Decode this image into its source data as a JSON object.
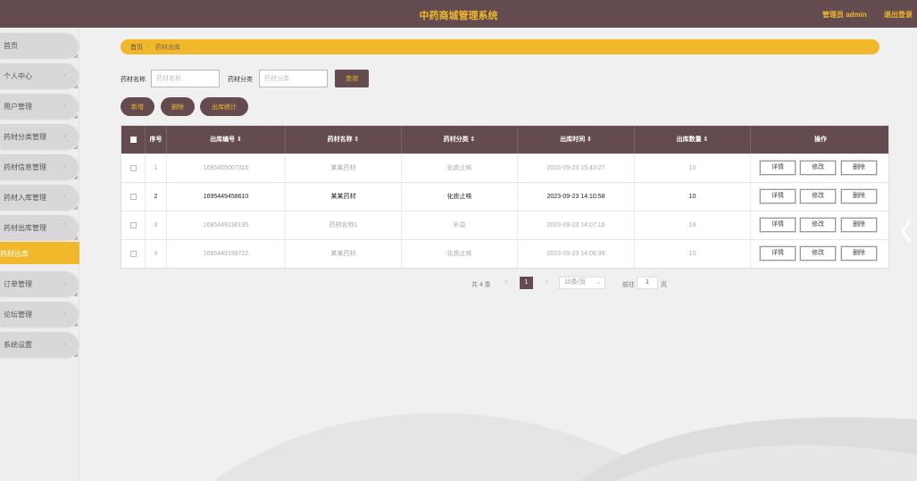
{
  "header": {
    "title": "中药商城管理系统",
    "admin": "管理员 admin",
    "logout": "退出登录"
  },
  "sidebar": {
    "items": [
      {
        "label": "首页"
      },
      {
        "label": "个人中心"
      },
      {
        "label": "用户管理"
      },
      {
        "label": "药材分类管理"
      },
      {
        "label": "药材信息管理"
      },
      {
        "label": "药材入库管理"
      },
      {
        "label": "药材出库管理"
      },
      {
        "label": "药材出库"
      },
      {
        "label": "订单管理"
      },
      {
        "label": "论坛管理"
      },
      {
        "label": "系统设置"
      }
    ]
  },
  "breadcrumb": {
    "home": "首页",
    "sep": ":",
    "current": "药材出库"
  },
  "filters": {
    "name_label": "药材名称",
    "name_placeholder": "药材名称",
    "category_label": "药材分类",
    "category_placeholder": "药材分类",
    "query": "查询"
  },
  "actions": {
    "add": "新增",
    "delete": "删除",
    "stats": "出库统计"
  },
  "table": {
    "headers": [
      "序号",
      "出库编号 ⇕",
      "药材名称 ⇕",
      "药材分类 ⇕",
      "出库时间 ⇕",
      "出库数量 ⇕",
      "操作"
    ],
    "rows": [
      {
        "idx": "1",
        "code": "1695455007316",
        "name": "某某药材",
        "category": "化痰止咳",
        "time": "2023-09-23 15:43:27",
        "qty": "10"
      },
      {
        "idx": "2",
        "code": "1695449458610",
        "name": "某某药材",
        "category": "化痰止咳",
        "time": "2023-09-23 14:10:58",
        "qty": "10"
      },
      {
        "idx": "3",
        "code": "1695449236195",
        "name": "药材名称1",
        "category": "补益",
        "time": "2023-09-23 14:07:16",
        "qty": "18"
      },
      {
        "idx": "4",
        "code": "1695449199722",
        "name": "某某药材",
        "category": "化痰止咳",
        "time": "2023-09-23 14:06:39",
        "qty": "10"
      }
    ],
    "op_detail": "详情",
    "op_edit": "修改",
    "op_delete": "删除"
  },
  "pagination": {
    "total": "共 4 条",
    "prev": "<",
    "current": "1",
    "next": ">",
    "page_size": "10条/页",
    "goto_label": "前往",
    "goto_value": "1",
    "page_suffix": "页"
  },
  "colors": {
    "primary": "#634b4f",
    "accent": "#f1b82c",
    "background": "#f1f0f0"
  }
}
